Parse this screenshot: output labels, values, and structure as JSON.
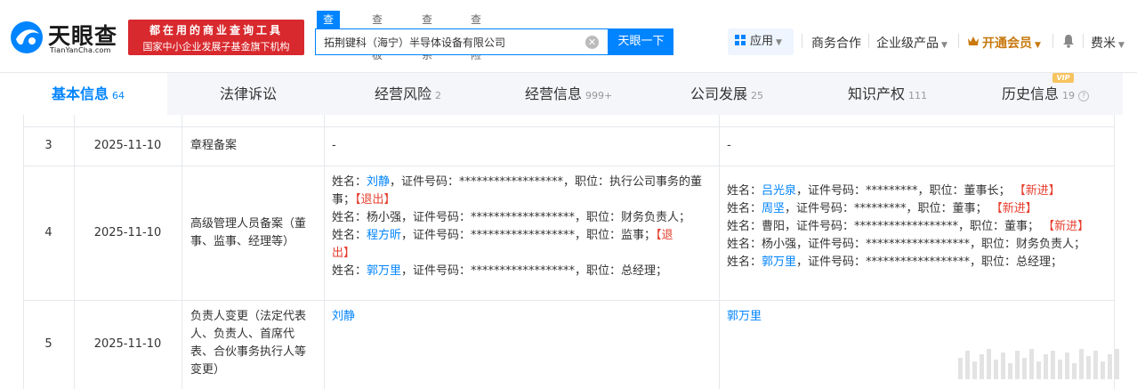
{
  "header": {
    "logo_text": "天眼查",
    "logo_sub": "TianYanCha.com",
    "promo_line1": "都在用的商业查询工具",
    "promo_line2": "国家中小企业发展子基金旗下机构",
    "search_tabs": [
      "查公司",
      "查老板",
      "查关系",
      "查风险"
    ],
    "search_value": "拓荆键科（海宁）半导体设备有限公司",
    "search_button": "天眼一下",
    "apps_label": "应用",
    "business": "商务合作",
    "enterprise": "企业级产品",
    "vip_label": "开通会员",
    "user": "费米"
  },
  "tabs": [
    {
      "label": "基本信息",
      "count": "64"
    },
    {
      "label": "法律诉讼",
      "count": ""
    },
    {
      "label": "经营风险",
      "count": "2"
    },
    {
      "label": "经营信息",
      "count": "999+"
    },
    {
      "label": "公司发展",
      "count": "25"
    },
    {
      "label": "知识产权",
      "count": "111"
    },
    {
      "label": "历史信息",
      "count": "19"
    }
  ],
  "vip_badge": "VIP",
  "rows": [
    {
      "index": "3",
      "date": "2025-11-10",
      "item": "章程备案",
      "before": "-",
      "after": "-"
    },
    {
      "index": "4",
      "date": "2025-11-10",
      "item_lines": [
        "高级管理人员备案（董",
        "事、监事、经理等）"
      ],
      "before_lines": [
        {
          "prefix": "姓名：",
          "name": "刘静",
          "rest": "，证件号码：******************，职位：执行公司事务的董"
        },
        {
          "prefix": "事；",
          "name": "",
          "rest": "",
          "tag": "【退出】"
        },
        {
          "prefix": "姓名：杨小强，证件号码：******************，职位：财务负责人；",
          "name": "",
          "rest": ""
        },
        {
          "prefix": "姓名：",
          "name": "程方昕",
          "rest": "，证件号码：******************，职位：监事；",
          "tag": "【退"
        },
        {
          "prefix": "",
          "name": "",
          "rest": "",
          "tag": "出】"
        },
        {
          "prefix": "姓名：",
          "name": "郭万里",
          "rest": "，证件号码：******************，职位：总经理；"
        }
      ],
      "after_lines": [
        {
          "prefix": "姓名：",
          "name": "吕光泉",
          "rest": "，证件号码：*********，职位：董事长；",
          "tag": "【新进】"
        },
        {
          "prefix": "姓名：",
          "name": "周坚",
          "rest": "，证件号码：*********，职位：董事；",
          "tag": "【新进】"
        },
        {
          "prefix": "姓名：曹阳，证件号码：******************，职位：董事；",
          "name": "",
          "rest": "",
          "tag": "【新进】"
        },
        {
          "prefix": "姓名：杨小强，证件号码：******************，职位：财务负责人；",
          "name": "",
          "rest": ""
        },
        {
          "prefix": "姓名：",
          "name": "郭万里",
          "rest": "，证件号码：******************，职位：总经理；"
        }
      ]
    },
    {
      "index": "5",
      "date": "2025-11-10",
      "item_lines": [
        "负责人变更（法定代表",
        "人、负责人、首席代",
        "表、合伙事务执行人等",
        "变更）"
      ],
      "before": "刘静",
      "after": "郭万里"
    }
  ],
  "colors": {
    "accent": "#0084ff",
    "red_tag": "#e63e2e",
    "promo": "#d8292e",
    "gold": "#c8780d"
  }
}
